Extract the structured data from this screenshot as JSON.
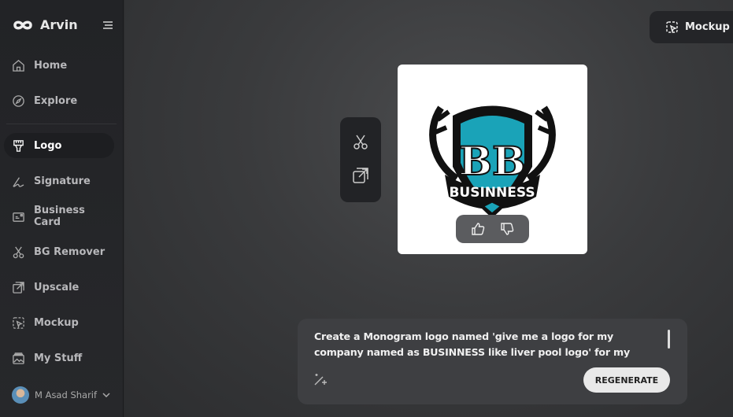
{
  "app": {
    "name": "Arvin"
  },
  "sidebar": {
    "items": [
      {
        "label": "Home",
        "icon": "home-icon"
      },
      {
        "label": "Explore",
        "icon": "compass-icon"
      },
      {
        "label": "Logo",
        "icon": "brush-icon",
        "active": true
      },
      {
        "label": "Signature",
        "icon": "signature-icon"
      },
      {
        "label": "Business Card",
        "icon": "card-icon"
      },
      {
        "label": "BG Remover",
        "icon": "scissors-icon"
      },
      {
        "label": "Upscale",
        "icon": "upscale-icon"
      },
      {
        "label": "Mockup",
        "icon": "mockup-icon"
      },
      {
        "label": "My Stuff",
        "icon": "gallery-icon"
      }
    ],
    "user": {
      "name": "M Asad Sharif"
    }
  },
  "header": {
    "mockup_label": "Mockup"
  },
  "logo_image": {
    "monogram": "BB",
    "banner": "BUSINNESS",
    "colors": {
      "teal": "#1aa3b8",
      "black": "#111111"
    }
  },
  "prompt": {
    "text": "Create a Monogram logo named 'give me a logo for my company named as BUSINNESS like liver pool logo' for my brand, which operates",
    "regenerate_label": "REGENERATE"
  }
}
